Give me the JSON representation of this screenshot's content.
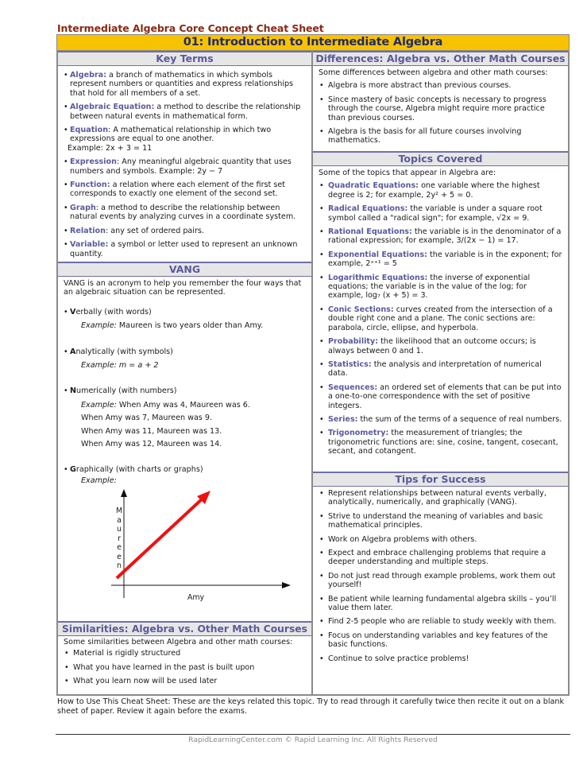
{
  "document": {
    "title": "Intermediate Algebra Core Concept Cheat Sheet",
    "banner": "01: Introduction to Intermediate Algebra"
  },
  "colors": {
    "title": "#8b2a14",
    "banner_bg": "#f7c200",
    "banner_text": "#1f2a6b",
    "section_header_text": "#5a5a9c",
    "section_header_bg": "#e6e6e6",
    "term": "#5a5a9c",
    "graph_line": "#ee1111"
  },
  "key_terms": {
    "heading": "Key Terms",
    "items": [
      {
        "term": "Algebra:",
        "definition": " a branch of mathematics in which symbols represent numbers or quantities and express relationships that hold for all members of a set."
      },
      {
        "term": "Algebraic Equation:",
        "definition": " a method to describe the relationship between natural events in mathematical form."
      },
      {
        "term": "Equation",
        "definition": ": A mathematical relationship in which two expressions are equal to one another.",
        "extra": "Example: 2x + 3 = 11"
      },
      {
        "term": "Expression",
        "definition": ": Any meaningful algebraic quantity that uses numbers and symbols. Example: 2y − 7"
      },
      {
        "term": "Function:",
        "definition": " a relation where each element of the first set corresponds to exactly one element of the second set."
      },
      {
        "term": "Graph",
        "definition": ": a method to describe the relationship between natural events by analyzing curves in a coordinate system."
      },
      {
        "term": "Relation",
        "definition": ": any set of ordered pairs."
      },
      {
        "term": "Variable:",
        "definition": " a symbol or letter used to represent an unknown quantity."
      }
    ]
  },
  "vang": {
    "heading": "VANG",
    "intro": "VANG is an acronym to help you remember the four ways that an algebraic situation can be represented.",
    "verbal": {
      "letter": "V",
      "rest": "erbally (with words)",
      "example_label": "Example:",
      "example": " Maureen is two years older than Amy."
    },
    "analytical": {
      "letter": "A",
      "rest": "nalytically (with symbols)",
      "example_label": "Example:",
      "example": " m = a + 2"
    },
    "numerical": {
      "letter": "N",
      "rest": "umerically (with numbers)",
      "example_label": "Example:",
      "lines": [
        " When Amy was 4, Maureen was 6.",
        "When Amy was 7, Maureen was 9.",
        "When Amy was 11, Maureen was 13.",
        "When Amy was 12, Maureen was 14."
      ]
    },
    "graphical": {
      "letter": "G",
      "rest": "raphically (with charts or graphs)",
      "example_label": "Example:",
      "graph": {
        "x_label": "Amy",
        "y_label_letters": [
          "M",
          "a",
          "u",
          "r",
          "e",
          "e",
          "n"
        ]
      }
    }
  },
  "similarities": {
    "heading": "Similarities: Algebra vs. Other Math Courses",
    "intro": "Some similarities between Algebra and other math courses:",
    "items": [
      "Material is rigidly structured",
      "What you have learned in the past is built upon",
      "What you learn now will be used later"
    ]
  },
  "differences": {
    "heading": "Differences: Algebra vs. Other Math Courses",
    "intro": "Some differences between algebra and other math courses:",
    "items": [
      "Algebra is more abstract than previous courses.",
      "Since mastery of basic concepts is necessary to progress through the course, Algebra might require more practice than previous courses.",
      "Algebra is the basis for all future courses involving mathematics."
    ]
  },
  "topics": {
    "heading": "Topics Covered",
    "intro": "Some of the topics that appear in Algebra are:",
    "items": [
      {
        "term": "Quadratic Equations:",
        "definition": " one variable where the highest degree is 2; for example, 2y² + 5 = 0."
      },
      {
        "term": "Radical Equations:",
        "definition": " the variable is under a square root symbol called a \"radical sign\"; for example, √2x = 9."
      },
      {
        "term": "Rational Equations:",
        "definition": " the variable is in the denominator of a rational expression; for example, 3/(2x − 1) = 17."
      },
      {
        "term": "Exponential Equations:",
        "definition": " the variable is in the exponent; for example, 2ˣ⁺¹ = 5"
      },
      {
        "term": "Logarithmic Equations:",
        "definition": " the inverse of exponential equations; the variable is in the value of the log; for example, log₇ (x + 5) = 3."
      },
      {
        "term": "Conic Sections:",
        "definition": " curves created from the intersection of a double right cone and a plane. The conic sections are: parabola, circle, ellipse, and hyperbola."
      },
      {
        "term": "Probability:",
        "definition": " the likelihood that an outcome occurs; is always between 0 and 1."
      },
      {
        "term": "Statistics:",
        "definition": " the analysis and interpretation of numerical data."
      },
      {
        "term": "Sequences:",
        "definition": " an ordered set of elements that can be put into a one-to-one correspondence with the set of positive integers."
      },
      {
        "term": "Series:",
        "definition": " the sum of the terms of a sequence of real numbers."
      },
      {
        "term": "Trigonometry:",
        "definition": " the measurement of triangles; the trigonometric functions are: sine, cosine, tangent, cosecant, secant, and cotangent."
      }
    ]
  },
  "tips": {
    "heading": "Tips for Success",
    "items": [
      "Represent relationships between natural events verbally, analytically, numerically, and graphically (VANG).",
      "Strive to understand the meaning of variables and basic mathematical principles.",
      "Work on Algebra problems with others.",
      "Expect and embrace challenging problems that require a deeper understanding and multiple steps.",
      "Do not just read through example problems, work them out yourself!",
      "Be patient while learning fundamental algebra skills – you’ll value them later.",
      "Find 2-5 people who are reliable to study weekly with them.",
      "Focus on understanding variables and key features of the basic functions.",
      "Continue to solve practice problems!"
    ]
  },
  "how_to_use": "How to Use This Cheat Sheet: These are the keys related this topic. Try to read through it carefully twice then recite it out on a blank sheet of paper. Review it again before the exams.",
  "footer": "RapidLearningCenter.com   © Rapid Learning Inc. All Rights Reserved"
}
